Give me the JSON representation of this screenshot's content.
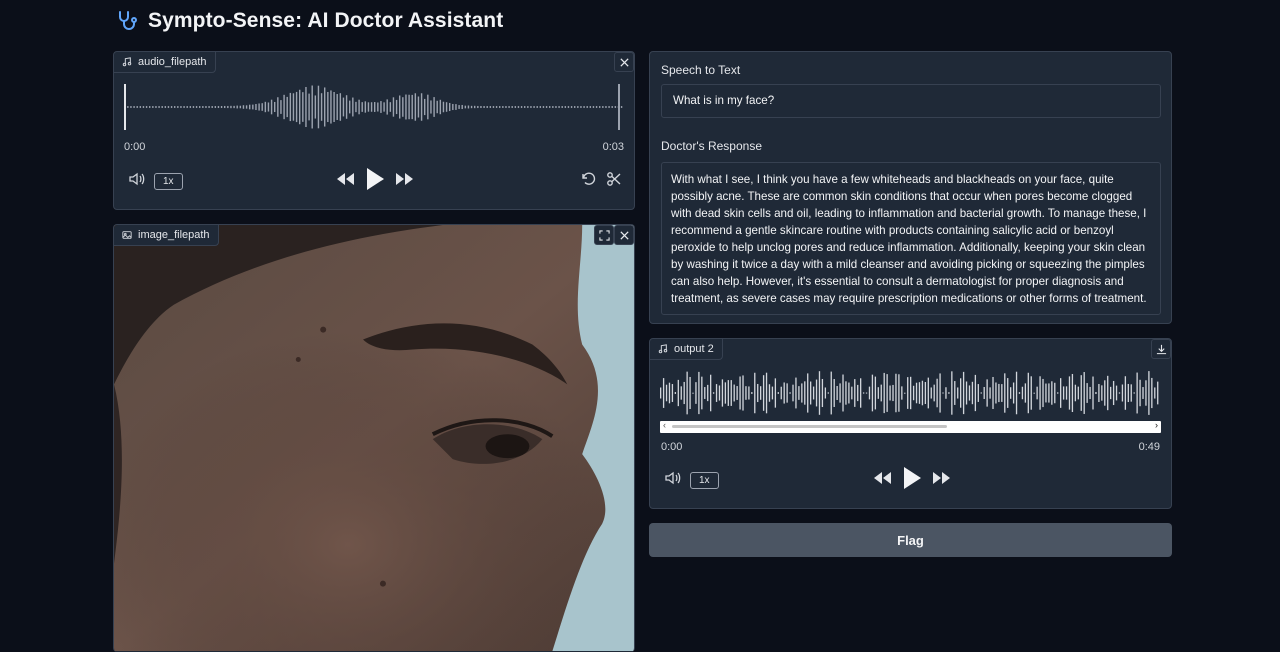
{
  "app": {
    "title": "Sympto-Sense: AI Doctor Assistant",
    "logo_icon": "stethoscope-icon"
  },
  "audio_input": {
    "label": "audio_filepath",
    "current_time": "0:00",
    "duration": "0:03",
    "speed": "1x",
    "icons": [
      "music-note-icon",
      "close-icon",
      "volume-icon",
      "rewind-icon",
      "play-icon",
      "fast-forward-icon",
      "undo-icon",
      "scissors-icon"
    ]
  },
  "image_input": {
    "label": "image_filepath",
    "icons": [
      "image-icon",
      "fullscreen-icon",
      "close-icon"
    ]
  },
  "speech_to_text": {
    "label": "Speech to Text",
    "value": "What is in my face?"
  },
  "doctor_response": {
    "label": "Doctor's Response",
    "value": "With what I see, I think you have a few whiteheads and blackheads on your face, quite possibly acne. These are common skin conditions that occur when pores become clogged with dead skin cells and oil, leading to inflammation and bacterial growth. To manage these, I recommend a gentle skincare routine with products containing salicylic acid or benzoyl peroxide to help unclog pores and reduce inflammation. Additionally, keeping your skin clean by washing it twice a day with a mild cleanser and avoiding picking or squeezing the pimples can also help. However, it's essential to consult a dermatologist for proper diagnosis and treatment, as severe cases may require prescription medications or other forms of treatment."
  },
  "audio_output": {
    "label": "output 2",
    "current_time": "0:00",
    "duration": "0:49",
    "speed": "1x",
    "icons": [
      "music-note-icon",
      "download-icon",
      "volume-icon",
      "rewind-icon",
      "play-icon",
      "fast-forward-icon"
    ]
  },
  "flag_button": {
    "label": "Flag"
  },
  "colors": {
    "background": "#0b0f19",
    "panel": "#1f2937",
    "border": "#374151",
    "button": "#4b5563",
    "logo_accent": "#3b82f6"
  }
}
